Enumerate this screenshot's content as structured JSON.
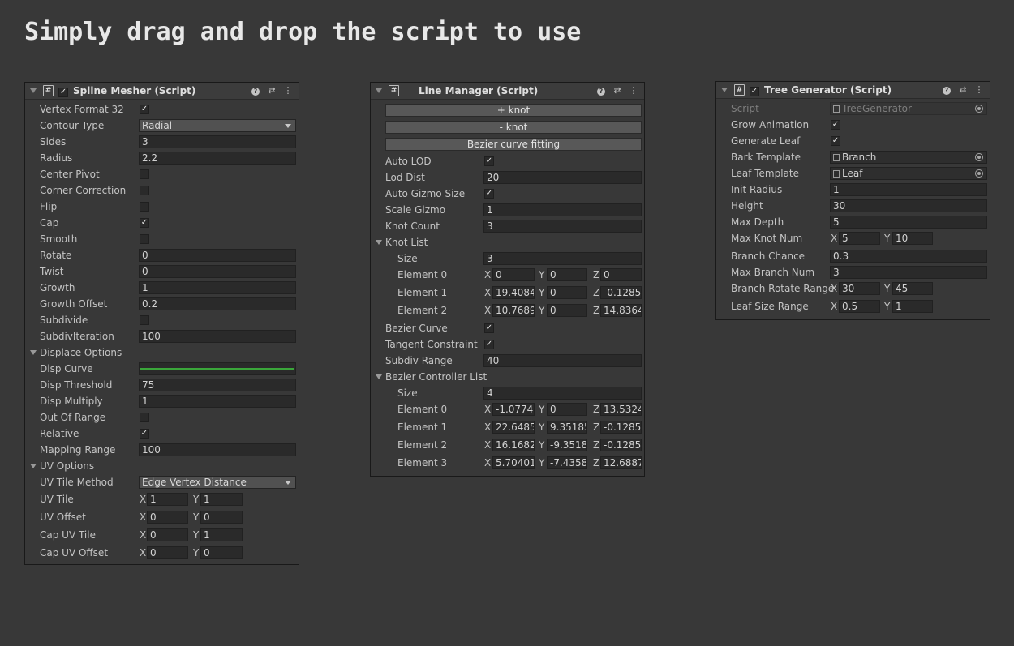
{
  "headline": "Simply drag and drop the script to use",
  "colors": {
    "background": "#383838",
    "field": "#2a2a2a",
    "curve": "#3aa63a"
  },
  "spline": {
    "title": "Spline Mesher (Script)",
    "enabled": true,
    "vertex_format_32": {
      "label": "Vertex Format 32",
      "checked": "✓"
    },
    "contour_type": {
      "label": "Contour Type",
      "value": "Radial"
    },
    "sides": {
      "label": "Sides",
      "value": "3"
    },
    "radius": {
      "label": "Radius",
      "value": "2.2"
    },
    "center_pivot": {
      "label": "Center Pivot"
    },
    "corner_correction": {
      "label": "Corner Correction"
    },
    "flip": {
      "label": "Flip"
    },
    "cap": {
      "label": "Cap",
      "checked": "✓"
    },
    "smooth": {
      "label": "Smooth"
    },
    "rotate": {
      "label": "Rotate",
      "value": "0"
    },
    "twist": {
      "label": "Twist",
      "value": "0"
    },
    "growth": {
      "label": "Growth",
      "value": "1"
    },
    "growth_offset": {
      "label": "Growth Offset",
      "value": "0.2"
    },
    "subdivide": {
      "label": "Subdivide"
    },
    "subdiv_iteration": {
      "label": "SubdivIteration",
      "value": "100"
    },
    "displace_options": "Displace Options",
    "disp_curve": {
      "label": "Disp Curve"
    },
    "disp_threshold": {
      "label": "Disp Threshold",
      "value": "75"
    },
    "disp_multiply": {
      "label": "Disp Multiply",
      "value": "1"
    },
    "out_of_range": {
      "label": "Out Of Range"
    },
    "relative": {
      "label": "Relative",
      "checked": "✓"
    },
    "mapping_range": {
      "label": "Mapping Range",
      "value": "100"
    },
    "uv_options": "UV Options",
    "uv_tile_method": {
      "label": "UV Tile Method",
      "value": "Edge Vertex Distance"
    },
    "uv_tile": {
      "label": "UV Tile",
      "x": "1",
      "y": "1"
    },
    "uv_offset": {
      "label": "UV Offset",
      "x": "0",
      "y": "0"
    },
    "cap_uv_tile": {
      "label": "Cap UV Tile",
      "x": "0",
      "y": "1"
    },
    "cap_uv_offset": {
      "label": "Cap UV Offset",
      "x": "0",
      "y": "0"
    }
  },
  "line": {
    "title": "Line Manager (Script)",
    "add_knot": "+ knot",
    "remove_knot": "- knot",
    "bezier_fitting": "Bezier curve fitting",
    "auto_lod": {
      "label": "Auto LOD",
      "checked": "✓"
    },
    "lod_dist": {
      "label": "Lod Dist",
      "value": "20"
    },
    "auto_gizmo_size": {
      "label": "Auto Gizmo Size",
      "checked": "✓"
    },
    "scale_gizmo": {
      "label": "Scale Gizmo",
      "value": "1"
    },
    "knot_count": {
      "label": "Knot Count",
      "value": "3"
    },
    "knot_list": {
      "label": "Knot List",
      "size_label": "Size",
      "size": "3",
      "elements": [
        {
          "label": "Element 0",
          "x": "0",
          "y": "0",
          "z": "0"
        },
        {
          "label": "Element 1",
          "x": "19.4084",
          "y": "0",
          "z": "-0.1285"
        },
        {
          "label": "Element 2",
          "x": "10.7689",
          "y": "0",
          "z": "14.8364"
        }
      ]
    },
    "bezier_curve": {
      "label": "Bezier Curve",
      "checked": "✓"
    },
    "tangent_constraint": {
      "label": "Tangent Constraint",
      "checked": "✓"
    },
    "subdiv_range": {
      "label": "Subdiv Range",
      "value": "40"
    },
    "bezier_controller_list": {
      "label": "Bezier Controller List",
      "size_label": "Size",
      "size": "4",
      "elements": [
        {
          "label": "Element 0",
          "x": "-1.0774",
          "y": "0",
          "z": "13.5324"
        },
        {
          "label": "Element 1",
          "x": "22.6485",
          "y": "9.35185",
          "z": "-0.1285"
        },
        {
          "label": "Element 2",
          "x": "16.1682",
          "y": "-9.3518",
          "z": "-0.1285"
        },
        {
          "label": "Element 3",
          "x": "5.70401",
          "y": "-7.4358",
          "z": "12.6887"
        }
      ]
    }
  },
  "tree": {
    "title": "Tree Generator (Script)",
    "enabled": true,
    "script": {
      "label": "Script",
      "value": "TreeGenerator"
    },
    "grow_animation": {
      "label": "Grow Animation",
      "checked": "✓"
    },
    "generate_leaf": {
      "label": "Generate Leaf",
      "checked": "✓"
    },
    "bark_template": {
      "label": "Bark Template",
      "value": "Branch"
    },
    "leaf_template": {
      "label": "Leaf Template",
      "value": "Leaf"
    },
    "init_radius": {
      "label": "Init Radius",
      "value": "1"
    },
    "height": {
      "label": "Height",
      "value": "30"
    },
    "max_depth": {
      "label": "Max Depth",
      "value": "5"
    },
    "max_knot_num": {
      "label": "Max Knot Num",
      "x": "5",
      "y": "10"
    },
    "branch_chance": {
      "label": "Branch Chance",
      "value": "0.3"
    },
    "max_branch_num": {
      "label": "Max Branch Num",
      "value": "3"
    },
    "branch_rotate_range": {
      "label": "Branch Rotate Range",
      "x": "30",
      "y": "45"
    },
    "leaf_size_range": {
      "label": "Leaf Size Range",
      "x": "0.5",
      "y": "1"
    }
  },
  "axes": {
    "x": "X",
    "y": "Y",
    "z": "Z"
  },
  "icons": {
    "help": "help-icon",
    "presets": "presets-icon",
    "menu": "kebab-menu-icon",
    "script": "script-icon"
  }
}
